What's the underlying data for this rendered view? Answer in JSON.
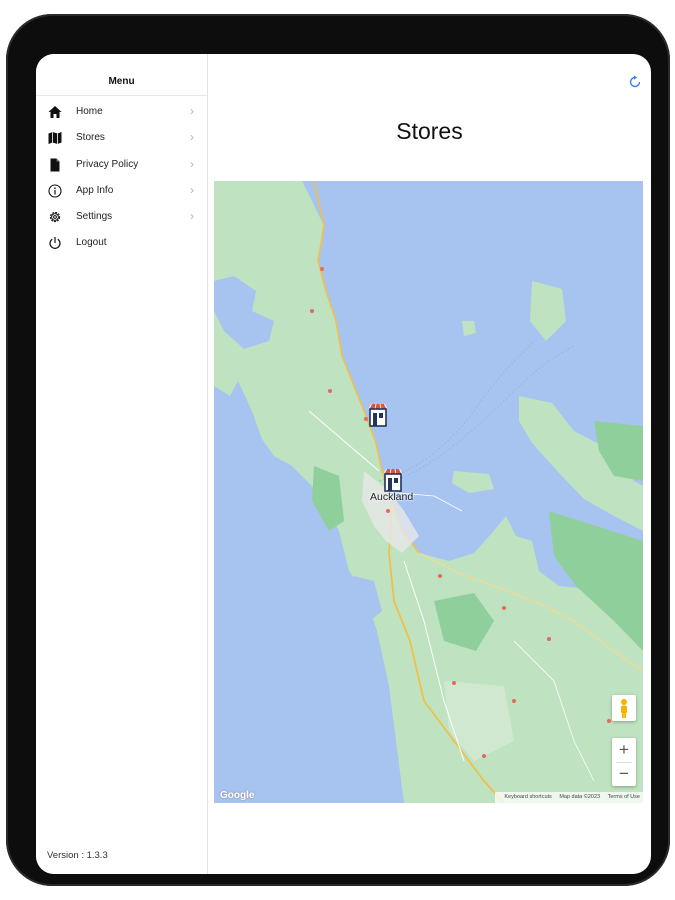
{
  "sidebar": {
    "title": "Menu",
    "items": [
      {
        "label": "Home",
        "icon": "home-icon",
        "chevron": "›"
      },
      {
        "label": "Stores",
        "icon": "map-icon",
        "chevron": "›"
      },
      {
        "label": "Privacy Policy",
        "icon": "document-icon",
        "chevron": "›"
      },
      {
        "label": "App Info",
        "icon": "info-icon",
        "chevron": "›"
      },
      {
        "label": "Settings",
        "icon": "gear-icon",
        "chevron": "›"
      },
      {
        "label": "Logout",
        "icon": "power-icon"
      }
    ],
    "version": "Version : 1.3.3"
  },
  "main": {
    "title": "Stores",
    "refresh_icon": "refresh-icon"
  },
  "map": {
    "city_label": "Auckland",
    "pins": [
      "store-pin",
      "store-pin"
    ],
    "zoom_in": "+",
    "zoom_out": "−",
    "google_logo": "Google",
    "attribution": {
      "shortcuts": "Keyboard shortcuts",
      "data": "Map data ©2023",
      "terms": "Terms of Use"
    },
    "colors": {
      "water": "#a7c4f1",
      "land": "#bfe2c0",
      "park": "#8fcf9b"
    }
  }
}
